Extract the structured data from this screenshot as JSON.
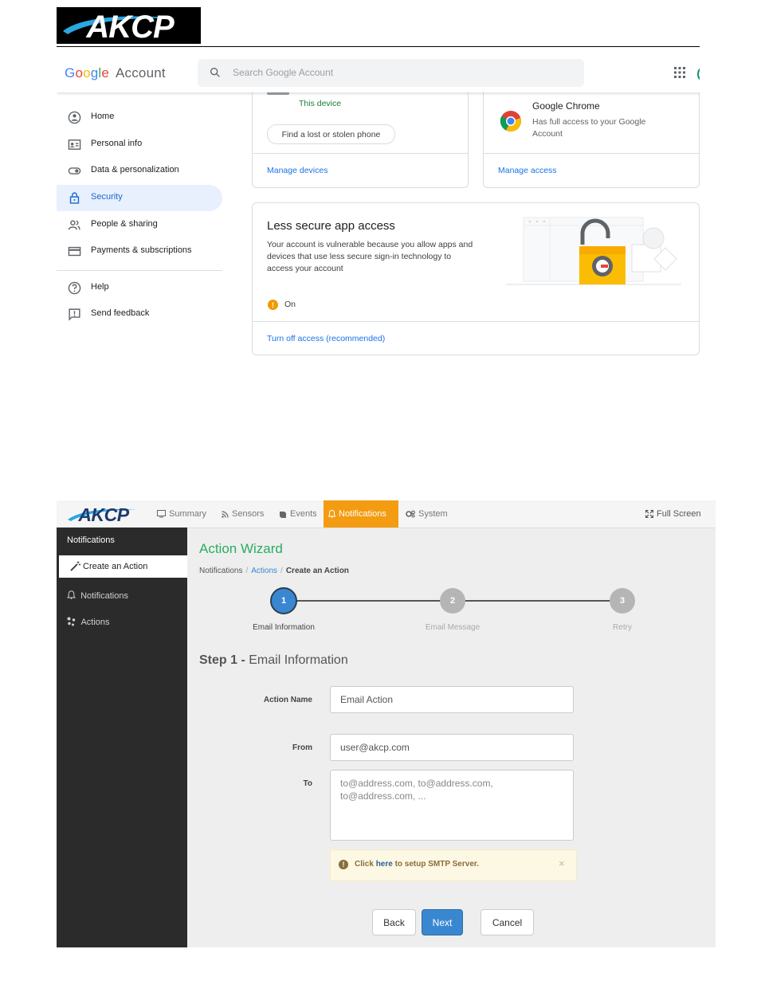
{
  "document": {
    "logo_text": "AKCP",
    "colors": {
      "rule": "#000000"
    }
  },
  "google": {
    "brand": {
      "g1": "G",
      "g2": "o",
      "g3": "o",
      "g4": "g",
      "g5": "l",
      "g6": "e",
      "word": "Account"
    },
    "brand_colors": [
      "#4285f4",
      "#ea4335",
      "#fbbc05",
      "#4285f4",
      "#34a853",
      "#ea4335"
    ],
    "search_placeholder": "Search Google Account",
    "nav": [
      {
        "label": "Home",
        "icon": "home-icon"
      },
      {
        "label": "Personal info",
        "icon": "id-card-icon"
      },
      {
        "label": "Data & personalization",
        "icon": "toggle-icon"
      },
      {
        "label": "Security",
        "icon": "lock-icon",
        "active": true
      },
      {
        "label": "People & sharing",
        "icon": "people-icon"
      },
      {
        "label": "Payments & subscriptions",
        "icon": "credit-card-icon"
      },
      {
        "label": "Help",
        "icon": "help-icon"
      },
      {
        "label": "Send feedback",
        "icon": "feedback-icon"
      }
    ],
    "devices_card": {
      "this_device": "This device",
      "find_phone_button": "Find a lost or stolen phone",
      "manage_link": "Manage devices"
    },
    "chrome_card": {
      "title": "Google Chrome",
      "desc_line1": "Has full access to your Google",
      "desc_line2": "Account",
      "manage_link": "Manage access"
    },
    "less_secure": {
      "title": "Less secure app access",
      "desc_line1": "Your account is vulnerable because you allow apps and",
      "desc_line2": "devices that use less secure sign-in technology to",
      "desc_line3": "access your account",
      "status_icon": "!",
      "status": "On",
      "action_link": "Turn off access (recommended)"
    }
  },
  "akcp": {
    "logo_text": "AKCP",
    "nav": [
      {
        "label": "Summary",
        "icon": "monitor-icon"
      },
      {
        "label": "Sensors",
        "icon": "rss-icon"
      },
      {
        "label": "Events",
        "icon": "book-icon"
      },
      {
        "label": "Notifications",
        "icon": "bell-icon",
        "active": true
      },
      {
        "label": "System",
        "icon": "gears-icon"
      }
    ],
    "fullscreen": "Full Screen",
    "sidebar": {
      "header": "Notifications",
      "create": "Create an Action",
      "notifications": "Notifications",
      "actions": "Actions"
    },
    "title": "Action Wizard",
    "breadcrumb": {
      "root": "Notifications",
      "sep1": "/",
      "mid": "Actions",
      "sep2": "/",
      "current": "Create an Action"
    },
    "steps": [
      {
        "num": "1",
        "label": "Email Information",
        "done": true
      },
      {
        "num": "2",
        "label": "Email Message",
        "done": false
      },
      {
        "num": "3",
        "label": "Retry",
        "done": false
      }
    ],
    "step_title": {
      "prefix": "Step 1 - ",
      "name": "Email Information"
    },
    "form": {
      "action_name_label": "Action Name",
      "action_name_value": "Email Action",
      "from_label": "From",
      "from_value": "user@akcp.com",
      "to_label": "To",
      "to_placeholder": "to@address.com, to@address.com,\nto@address.com, ..."
    },
    "alert": {
      "icon": "!",
      "before": "Click ",
      "link": "here",
      "after": " to setup SMTP Server.",
      "close": "×"
    },
    "buttons": {
      "back": "Back",
      "next": "Next",
      "cancel": "Cancel"
    },
    "colors": {
      "accent": "#f39c12",
      "title": "#27ae60",
      "primary": "#3a87d1",
      "sidebar": "#2b2b2b"
    }
  }
}
